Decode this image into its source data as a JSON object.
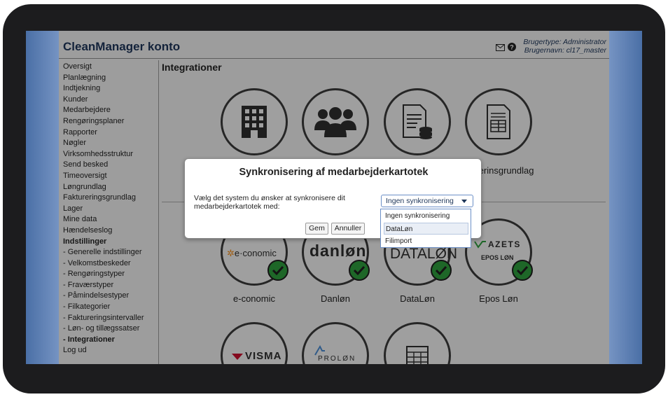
{
  "header": {
    "app_title": "CleanManager konto",
    "user_type": "Brugertype: Administrator",
    "user_name": "Brugernavn: cl17_master"
  },
  "sidebar": {
    "items": [
      {
        "label": "Oversigt",
        "bold": false
      },
      {
        "label": "Planlægning",
        "bold": false
      },
      {
        "label": "Indtjekning",
        "bold": false
      },
      {
        "label": "Kunder",
        "bold": false
      },
      {
        "label": "Medarbejdere",
        "bold": false
      },
      {
        "label": "Rengøringsplaner",
        "bold": false
      },
      {
        "label": "Rapporter",
        "bold": false
      },
      {
        "label": "Nøgler",
        "bold": false
      },
      {
        "label": "Virksomhedsstruktur",
        "bold": false
      },
      {
        "label": "Send besked",
        "bold": false
      },
      {
        "label": "Timeoversigt",
        "bold": false
      },
      {
        "label": "Løngrundlag",
        "bold": false
      },
      {
        "label": "Faktureringsgrundlag",
        "bold": false
      },
      {
        "label": "Lager",
        "bold": false
      },
      {
        "label": "Mine data",
        "bold": false
      },
      {
        "label": "Hændelseslog",
        "bold": false
      },
      {
        "label": "Indstillinger",
        "bold": true
      },
      {
        "label": " - Generelle indstillinger",
        "bold": false
      },
      {
        "label": " - Velkomstbeskeder",
        "bold": false
      },
      {
        "label": " - Rengøringstyper",
        "bold": false
      },
      {
        "label": " - Fraværstyper",
        "bold": false
      },
      {
        "label": " - Påmindelsestyper",
        "bold": false
      },
      {
        "label": " - Filkategorier",
        "bold": false
      },
      {
        "label": " - Faktureringsintervaller",
        "bold": false
      },
      {
        "label": " - Løn- og tillægssatser",
        "bold": false
      },
      {
        "label": " - Integrationer",
        "bold": true
      },
      {
        "label": "Log ud",
        "bold": false
      }
    ]
  },
  "main": {
    "section_title": "Integrationer",
    "top_row_visible_label": "kturerinsgrundlag",
    "integrations": [
      {
        "label": "e-conomic",
        "logo": "e·conomic"
      },
      {
        "label": "Danløn",
        "logo": "danløn"
      },
      {
        "label": "DataLøn",
        "logo": "DATALØN"
      },
      {
        "label": "Epos Løn",
        "logo_top": "AZETS",
        "logo_bottom": "EPOS LØN"
      }
    ],
    "bottom_logos": {
      "visma": "VISMA",
      "prolon": "PROLØN"
    }
  },
  "modal": {
    "title": "Synkronisering af medarbejderkartotek",
    "text": "Vælg det system du ønsker at synkronisere dit medarbejderkartotek med:",
    "select_value": "Ingen synkronisering",
    "options": [
      "Ingen synkronisering",
      "DataLøn",
      "Filimport"
    ],
    "save_label": "Gem",
    "cancel_label": "Annuller"
  },
  "colors": {
    "brand_text": "#1d3558",
    "check_green": "#2e9d3e",
    "danlon_red": "#e8523f",
    "visma_red": "#c8102e",
    "econ_orange": "#f28c1b"
  }
}
